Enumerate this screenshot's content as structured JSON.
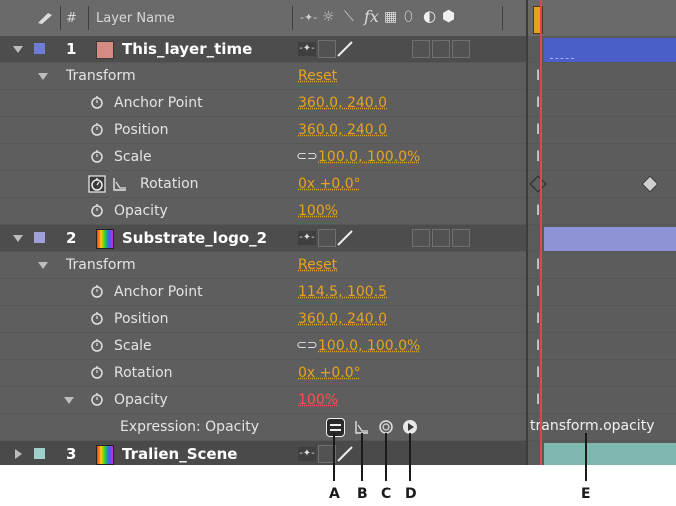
{
  "header": {
    "hash_label": "#",
    "layer_name_label": "Layer Name",
    "fx_label": "fx"
  },
  "layers": [
    {
      "number": "1",
      "name": "This_layer_time",
      "color": "#d48c82",
      "label_color": "#6f7cd8",
      "transform": {
        "label": "Transform",
        "reset": "Reset",
        "properties": [
          {
            "name": "Anchor Point",
            "value": "360.0, 240.0"
          },
          {
            "name": "Position",
            "value": "360.0, 240.0"
          },
          {
            "name": "Scale",
            "value": "100.0, 100.0%"
          },
          {
            "name": "Rotation",
            "value": "0x +0.0°"
          },
          {
            "name": "Opacity",
            "value": "100%"
          }
        ]
      }
    },
    {
      "number": "2",
      "name": "Substrate_logo_2",
      "label_color": "#9fa0dc",
      "transform": {
        "label": "Transform",
        "reset": "Reset",
        "properties": [
          {
            "name": "Anchor Point",
            "value": "114.5, 100.5"
          },
          {
            "name": "Position",
            "value": "360.0, 240.0"
          },
          {
            "name": "Scale",
            "value": "100.0, 100.0%"
          },
          {
            "name": "Rotation",
            "value": "0x +0.0°"
          },
          {
            "name": "Opacity",
            "value": "100%"
          }
        ],
        "expression_label": "Expression: Opacity",
        "expression_text": "transform.opacity"
      }
    },
    {
      "number": "3",
      "name": "Tralien_Scene",
      "label_color": "#9fd0cc"
    }
  ],
  "callouts": [
    "A",
    "B",
    "C",
    "D",
    "E"
  ],
  "colors": {
    "value_orange": "#e8a31c",
    "value_red": "#ff4f4f",
    "timeline_blue": "#4a5fc7",
    "timeline_lavender": "#8e92d6",
    "timeline_teal": "#7fb8ae",
    "playhead": "#e8404f"
  }
}
